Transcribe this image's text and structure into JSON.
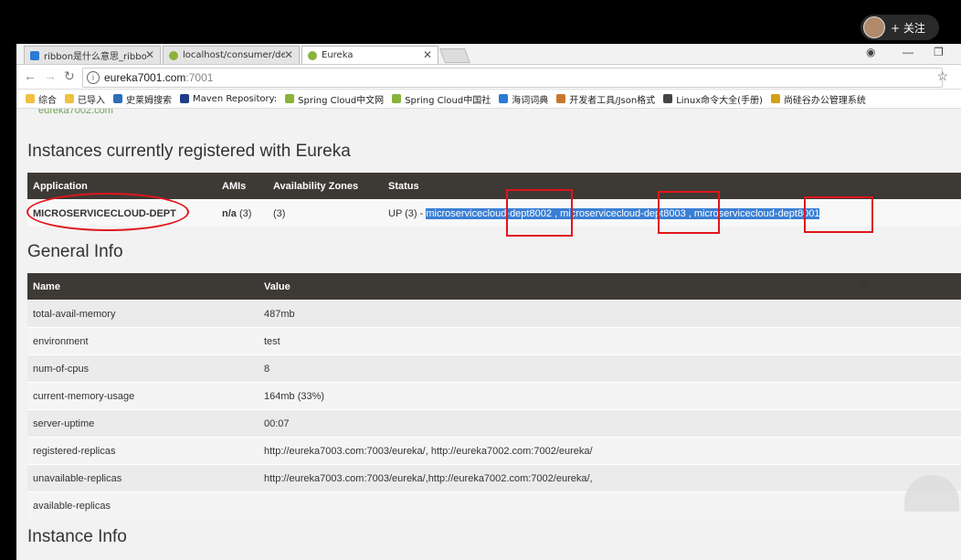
{
  "overlay": {
    "follow_label": "+ 关注"
  },
  "tabs": [
    {
      "label": "ribbon是什么意思_ribbon",
      "icon": "d-icon",
      "color": "#2b7ad6"
    },
    {
      "label": "localhost/consumer/dept",
      "icon": "leaf-icon",
      "color": "#8ab33b"
    },
    {
      "label": "Eureka",
      "icon": "leaf-icon",
      "color": "#8ab33b"
    }
  ],
  "address": {
    "host": "eureka7001.com",
    "port": ":7001"
  },
  "bookmarks": [
    {
      "label": "综合",
      "color": "#f0c040"
    },
    {
      "label": "已导入",
      "color": "#f0c040"
    },
    {
      "label": "史莱姆搜索",
      "color": "#2a6fb8"
    },
    {
      "label": "Maven Repository:",
      "color": "#1d3f8a"
    },
    {
      "label": "Spring Cloud中文网",
      "color": "#8ab33b"
    },
    {
      "label": "Spring Cloud中国社",
      "color": "#8ab33b"
    },
    {
      "label": "海词词典",
      "color": "#2b7ad6"
    },
    {
      "label": "开发者工具/Json格式",
      "color": "#c8782a"
    },
    {
      "label": "Linux命令大全(手册)",
      "color": "#444444"
    },
    {
      "label": "尚硅谷办公管理系统",
      "color": "#d4a017"
    }
  ],
  "page": {
    "replica_link": "eureka7002.com",
    "instances_title": "Instances currently registered with Eureka",
    "instances_headers": [
      "Application",
      "AMIs",
      "Availability Zones",
      "Status"
    ],
    "instance": {
      "application": "MICROSERVICECLOUD-DEPT",
      "amis": "n/a",
      "amis_count": "(3)",
      "zones": "(3)",
      "status_prefix": "UP (3) -",
      "links": [
        "microservicecloud-dept8002",
        "microservicecloud-dept8003",
        "microservicecloud-dept8001"
      ]
    },
    "general_title": "General Info",
    "general_headers": [
      "Name",
      "Value"
    ],
    "general_rows": [
      {
        "name": "total-avail-memory",
        "value": "487mb"
      },
      {
        "name": "environment",
        "value": "test"
      },
      {
        "name": "num-of-cpus",
        "value": "8"
      },
      {
        "name": "current-memory-usage",
        "value": "164mb (33%)"
      },
      {
        "name": "server-uptime",
        "value": "00:07"
      },
      {
        "name": "registered-replicas",
        "value": "http://eureka7003.com:7003/eureka/, http://eureka7002.com:7002/eureka/"
      },
      {
        "name": "unavailable-replicas",
        "value": "http://eureka7003.com:7003/eureka/,http://eureka7002.com:7002/eureka/,"
      },
      {
        "name": "available-replicas",
        "value": ""
      }
    ],
    "instance_info_title": "Instance Info"
  }
}
